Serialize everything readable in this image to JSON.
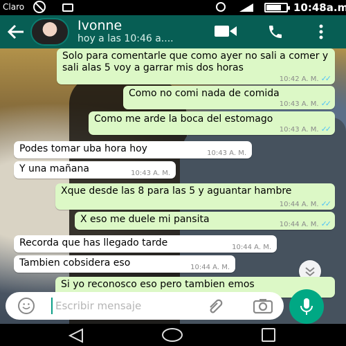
{
  "status_bar": {
    "carrier": "Claro",
    "time": "10:48a.m."
  },
  "contact": {
    "name": "Ivonne",
    "subtitle": "hoy a las 10:46 a...."
  },
  "messages": [
    {
      "dir": "out",
      "text": "Solo para comentarle que como ayer no sali a comer y sali alas 5 voy a garrar mis dos horas",
      "time": "10:42 A. M.",
      "read": true
    },
    {
      "dir": "out",
      "text": "Como no comi nada de comida",
      "time": "10:43 A. M.",
      "read": true
    },
    {
      "dir": "out",
      "text": "Como me arde la boca del estomago",
      "time": "10:43 A. M.",
      "read": true
    },
    {
      "dir": "in",
      "text": "Podes tomar uba hora hoy",
      "time": "10:43 A. M."
    },
    {
      "dir": "in",
      "text": "Y una mañana",
      "time": "10:43 A. M."
    },
    {
      "dir": "out",
      "text": "Xque desde las 8 para las 5 y aguantar hambre",
      "time": "10:44 A. M.",
      "read": true
    },
    {
      "dir": "out",
      "text": "X eso me duele mi pansita",
      "time": "10:44 A. M.",
      "read": true
    },
    {
      "dir": "in",
      "text": "Recorda que has llegado tarde",
      "time": "10:44 A. M."
    },
    {
      "dir": "in",
      "text": "Tambien cobsidera eso",
      "time": "10:44 A. M."
    },
    {
      "dir": "out",
      "text": "Si yo reconosco eso pero tambien emos",
      "time": "",
      "read": false
    }
  ],
  "input": {
    "placeholder": "Escribir mensaje"
  },
  "colors": {
    "header": "#075e54",
    "outgoing": "#dcf8c6",
    "incoming": "#ffffff",
    "accent": "#00a884"
  }
}
